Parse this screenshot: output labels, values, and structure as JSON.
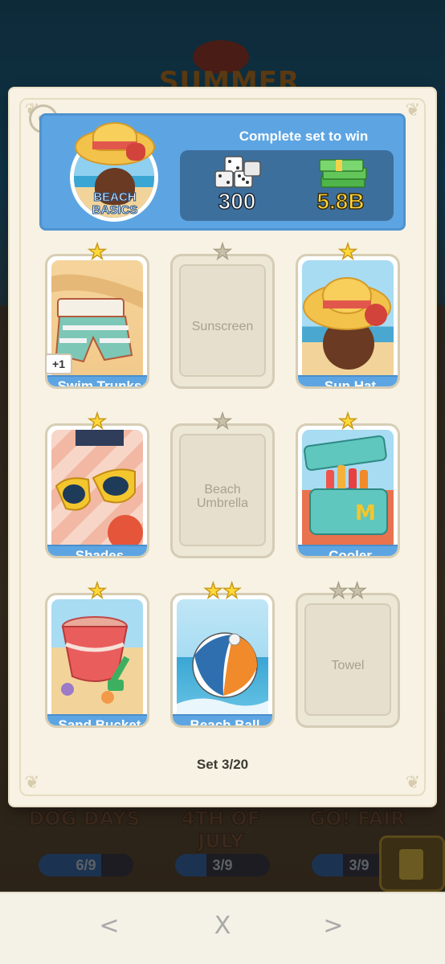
{
  "background": {
    "event_title": "SUMMER",
    "sets": [
      {
        "name": "DOG DAYS",
        "progress": "6/9"
      },
      {
        "name": "4TH OF JULY",
        "progress": "3/9"
      },
      {
        "name": "GO! FAIR",
        "progress": "3/9"
      }
    ]
  },
  "header": {
    "set_name": "BEACH BASICS",
    "reward_title": "Complete set to win",
    "reward_dice": "300",
    "reward_cash": "5.8B"
  },
  "cards": [
    {
      "name": "Swim Trunks",
      "stars": 1,
      "owned": true,
      "duplicates": "+1"
    },
    {
      "name": "Sunscreen",
      "stars": 1,
      "owned": false
    },
    {
      "name": "Sun Hat",
      "stars": 1,
      "owned": true
    },
    {
      "name": "Shades",
      "stars": 1,
      "owned": true
    },
    {
      "name": "Beach Umbrella",
      "stars": 1,
      "owned": false
    },
    {
      "name": "Cooler",
      "stars": 1,
      "owned": true
    },
    {
      "name": "Sand Bucket",
      "stars": 1,
      "owned": true
    },
    {
      "name": "Beach Ball",
      "stars": 2,
      "owned": true
    },
    {
      "name": "Towel",
      "stars": 2,
      "owned": false
    }
  ],
  "set_counter": "Set 3/20",
  "nav": {
    "prev": "<",
    "close": "X",
    "next": ">"
  },
  "colors": {
    "header_blue": "#5da5e2",
    "star_gold": "#ffd83a",
    "cash_yellow": "#ffd93b"
  }
}
